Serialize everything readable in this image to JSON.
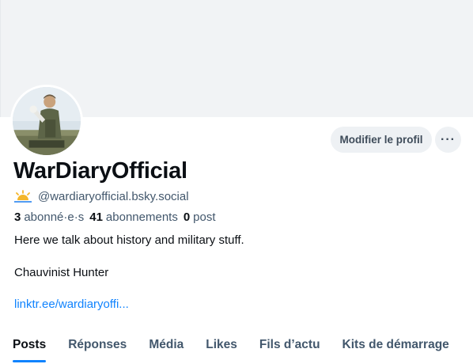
{
  "profile": {
    "display_name": "WarDiaryOfficial",
    "handle": "@wardiaryofficial.bsky.social",
    "handle_icon": "sun-icon",
    "stats": {
      "followers_count": "3",
      "followers_label": "abonné·e·s",
      "following_count": "41",
      "following_label": "abonnements",
      "posts_count": "0",
      "posts_label": "post"
    },
    "bio_line1": "Here we talk about history and military stuff.",
    "bio_line2": "Chauvinist Hunter",
    "link": "linktr.ee/wardiaryoffi..."
  },
  "actions": {
    "edit_label": "Modifier le profil",
    "more_label": "···"
  },
  "tabs": [
    {
      "label": "Posts",
      "active": true
    },
    {
      "label": "Réponses",
      "active": false
    },
    {
      "label": "Média",
      "active": false
    },
    {
      "label": "Likes",
      "active": false
    },
    {
      "label": "Fils d’actu",
      "active": false
    },
    {
      "label": "Kits de démarrage",
      "active": false
    }
  ],
  "colors": {
    "accent": "#1083fe",
    "banner": "#f1f3f5",
    "button_bg": "#eef1f4",
    "muted_text": "#42576c"
  }
}
